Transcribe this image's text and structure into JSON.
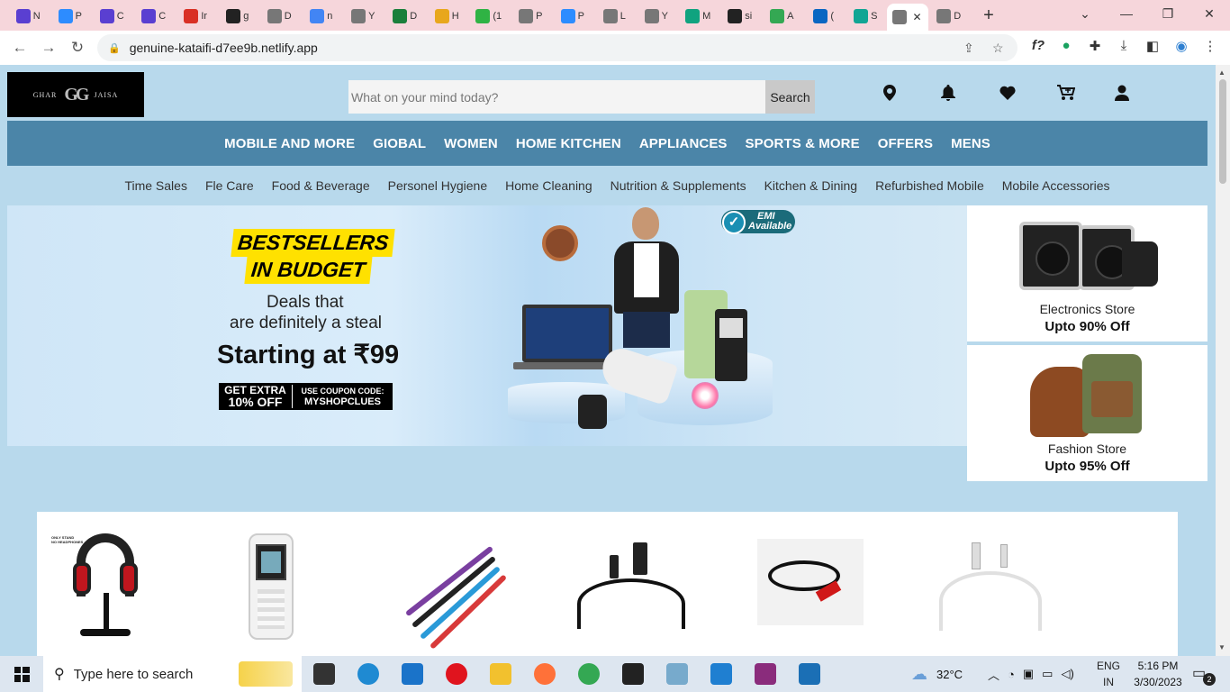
{
  "browser": {
    "tabs": [
      {
        "label": "N",
        "color": "#5a3fd1"
      },
      {
        "label": "P",
        "color": "#2d8cff"
      },
      {
        "label": "C",
        "color": "#5a3fd1"
      },
      {
        "label": "C",
        "color": "#5a3fd1"
      },
      {
        "label": "Ir",
        "color": "#d93025"
      },
      {
        "label": "g",
        "color": "#222222"
      },
      {
        "label": "D",
        "color": "#777777"
      },
      {
        "label": "n",
        "color": "#4285f4"
      },
      {
        "label": "Y",
        "color": "#777777"
      },
      {
        "label": "D",
        "color": "#1b7f3b"
      },
      {
        "label": "H",
        "color": "#e8a71c"
      },
      {
        "label": "(1",
        "color": "#2fb344"
      },
      {
        "label": "P",
        "color": "#777777"
      },
      {
        "label": "P",
        "color": "#2d8cff"
      },
      {
        "label": "L",
        "color": "#777777"
      },
      {
        "label": "Y",
        "color": "#777777"
      },
      {
        "label": "M",
        "color": "#10a37f"
      },
      {
        "label": "si",
        "color": "#222222"
      },
      {
        "label": "A",
        "color": "#34a853"
      },
      {
        "label": "(",
        "color": "#0a66c2"
      },
      {
        "label": "S",
        "color": "#12a594"
      },
      {
        "label": "",
        "color": "#777777"
      },
      {
        "label": "D",
        "color": "#777777"
      }
    ],
    "active_tab_index": 21,
    "new_tab": "+",
    "url": "genuine-kataifi-d7ee9b.netlify.app",
    "ext_label": "f?"
  },
  "site": {
    "logo_left": "GHAR",
    "logo_mark": "GG",
    "logo_right": "JAISA",
    "search_placeholder": "What on your mind today?",
    "search_button": "Search",
    "header_icons": [
      "location-icon",
      "bell-icon",
      "heart-icon",
      "cart-icon",
      "user-icon"
    ],
    "categories": [
      "MOBILE AND MORE",
      "GIOBAL",
      "WOMEN",
      "HOME KITCHEN",
      "APPLIANCES",
      "SPORTS & MORE",
      "OFFERS",
      "MENS"
    ],
    "subnav": [
      "Time Sales",
      "Fle Care",
      "Food & Beverage",
      "Personel Hygiene",
      "Home Cleaning",
      "Nutrition & Supplements",
      "Kitchen & Dining",
      "Refurbished Mobile",
      "Mobile Accessories"
    ],
    "banner": {
      "line1": "BESTSELLERS",
      "line2": "IN BUDGET",
      "deal1": "Deals that",
      "deal2": "are definitely a steal",
      "starting": "Starting at ₹99",
      "extra_1": "GET EXTRA",
      "extra_2": "10% OFF",
      "coupon_1": "USE COUPON CODE:",
      "coupon_2": "MYSHOPCLUES",
      "emi_1": "EMI",
      "emi_2": "Available"
    },
    "promos": [
      {
        "name": "Electronics Store",
        "offer": "Upto 90% Off"
      },
      {
        "name": "Fashion Store",
        "offer": "Upto 95% Off"
      }
    ],
    "product_note_1": "ONLY STAND",
    "product_note_2": "NO HEADPHONES"
  },
  "taskbar": {
    "search_placeholder": "Type here to search",
    "apps": [
      {
        "name": "task-view-icon",
        "color": "#333333"
      },
      {
        "name": "edge-icon",
        "color": "#1f8ad2"
      },
      {
        "name": "mail-icon",
        "color": "#1a73c9"
      },
      {
        "name": "opera-icon",
        "color": "#e0141e"
      },
      {
        "name": "file-explorer-icon",
        "color": "#f2c12e"
      },
      {
        "name": "firefox-icon",
        "color": "#ff7139"
      },
      {
        "name": "chrome-icon",
        "color": "#34a853"
      },
      {
        "name": "sticky-notes-icon",
        "color": "#222222"
      },
      {
        "name": "gitkraken-icon",
        "color": "#7ac"
      },
      {
        "name": "vscode-icon",
        "color": "#1f7fd1"
      },
      {
        "name": "winrar-icon",
        "color": "#8a2c7c"
      },
      {
        "name": "photos-icon",
        "color": "#1b6fb5"
      }
    ],
    "weather": "32°C",
    "lang_1": "ENG",
    "lang_2": "IN",
    "time": "5:16 PM",
    "date": "3/30/2023",
    "notifications": "2"
  }
}
